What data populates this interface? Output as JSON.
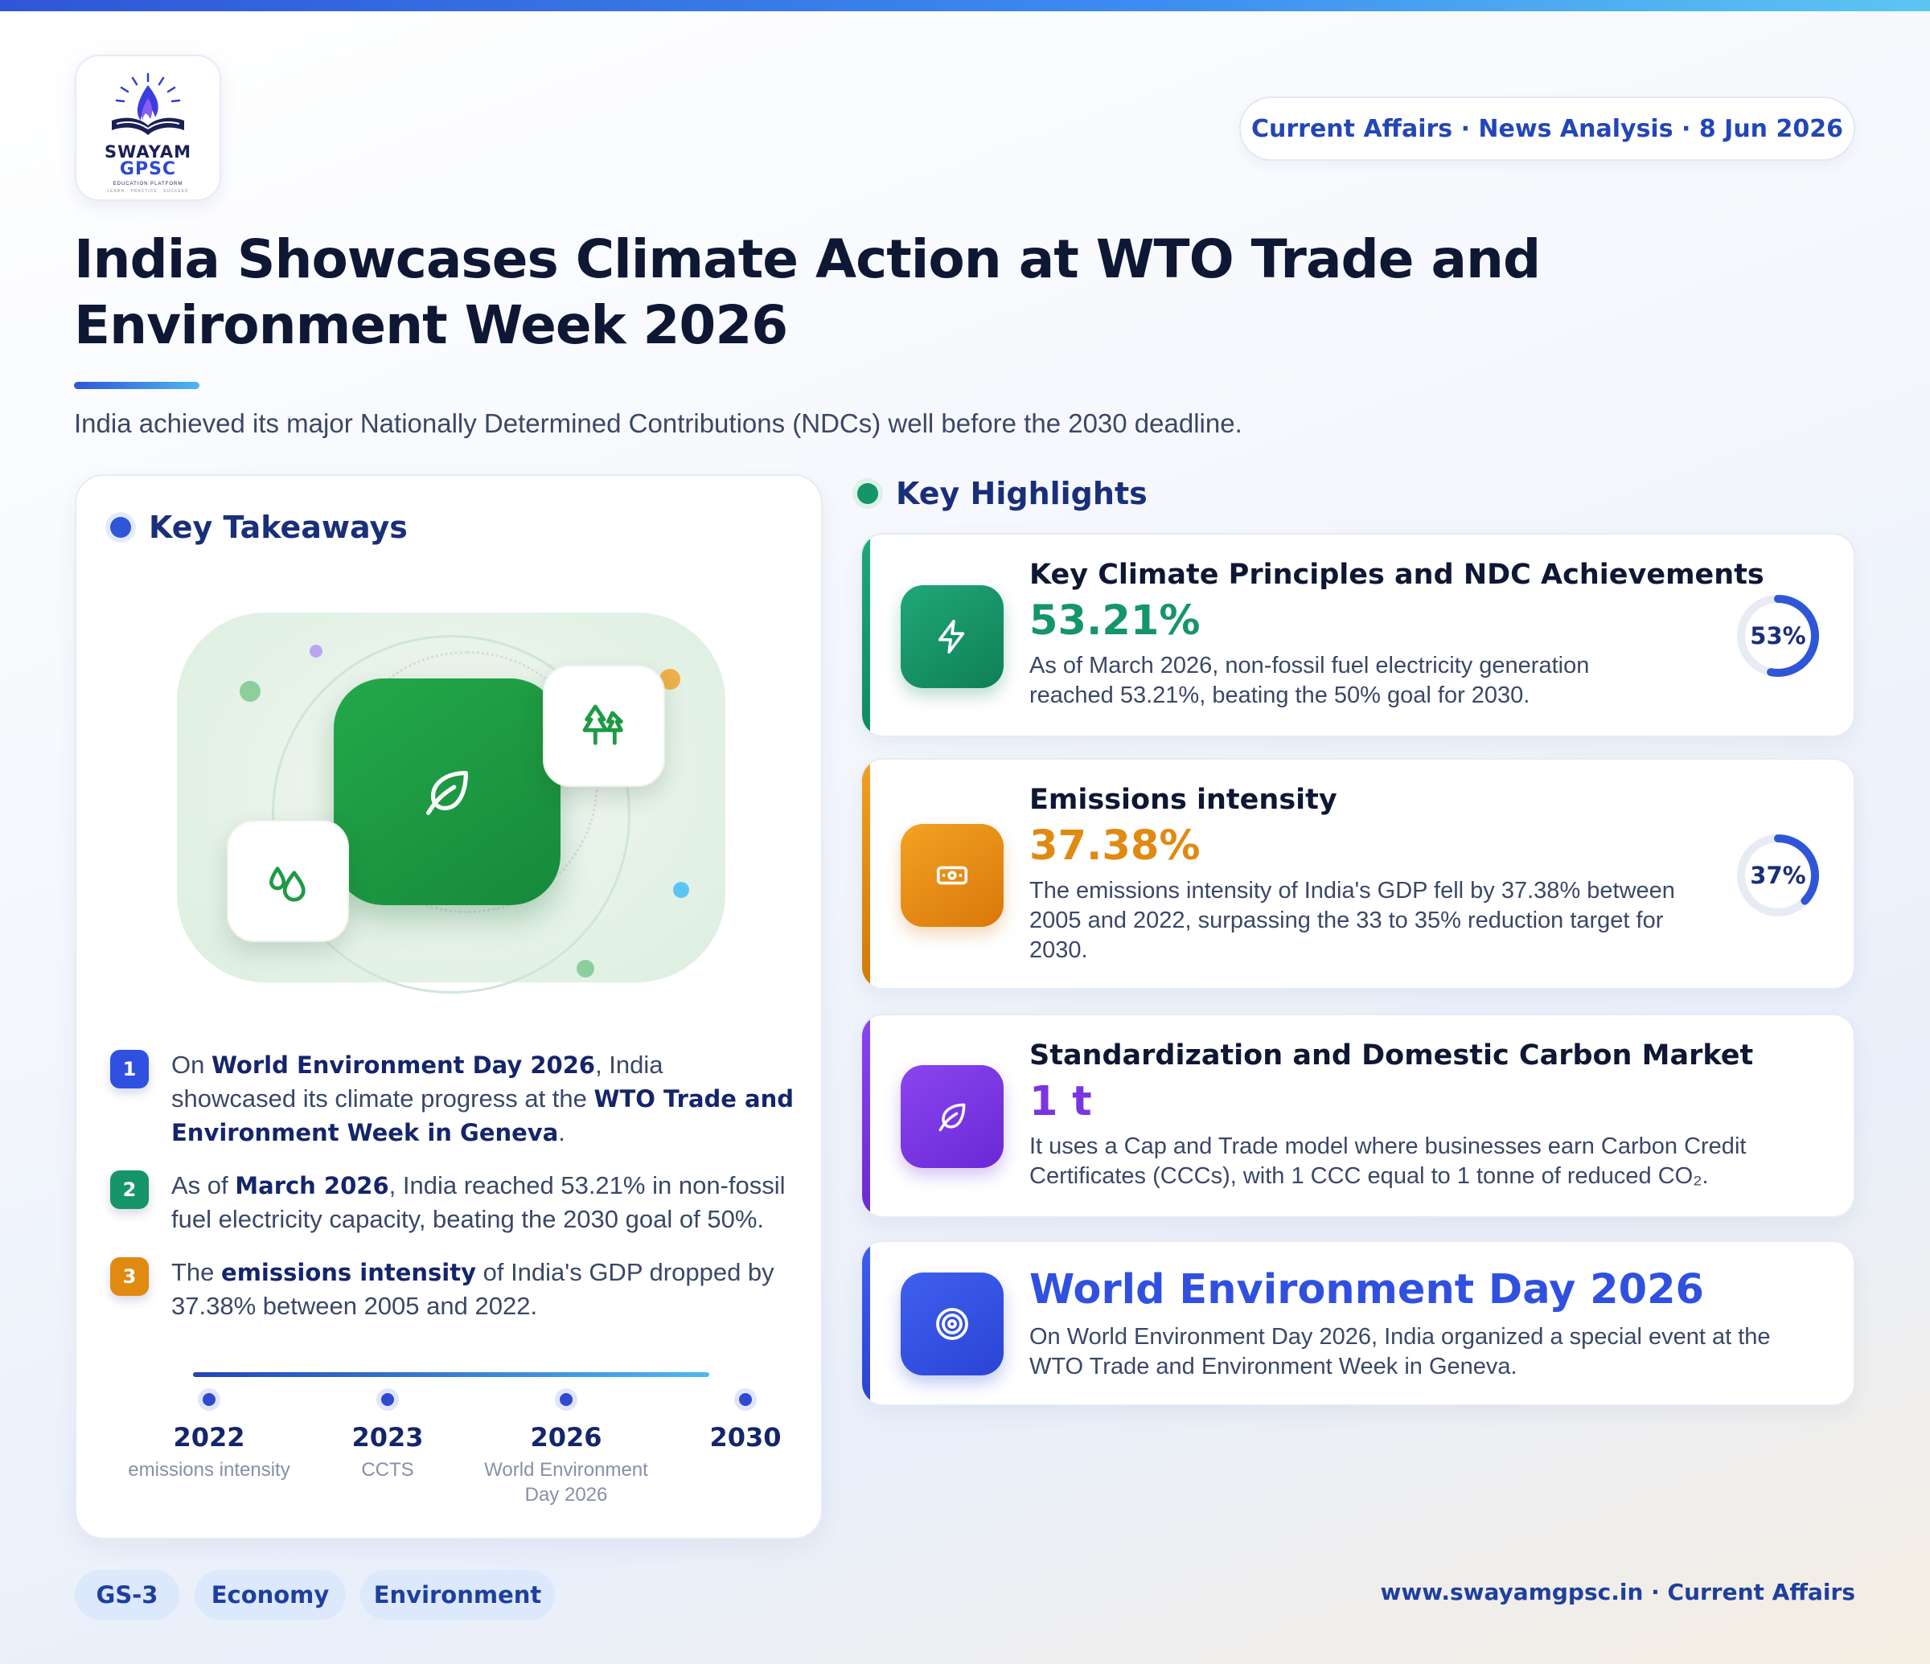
{
  "brand": {
    "name_line1": "SWAYAM",
    "name_line2": "GPSC",
    "tagline": "EDUCATION PLATFORM",
    "motto": "LEARN · PRACTICE · SUCCEED"
  },
  "header": {
    "date_pill": "Current Affairs · News Analysis · 8 Jun 2026",
    "title": "India Showcases Climate Action at WTO Trade and Environment Week 2026",
    "subtitle": "India achieved its major Nationally Determined Contributions (NDCs) well before the 2030 deadline."
  },
  "takeaways": {
    "heading": "Key Takeaways",
    "items": [
      {
        "num": "1",
        "p1": "On ",
        "b1": "World Environment Day 2026",
        "p2": ", India showcased its climate progress at the ",
        "b2": "WTO Trade and Environment Week in Geneva",
        "p3": "."
      },
      {
        "num": "2",
        "p1": "As of ",
        "b1": "March 2026",
        "p2": ", India reached 53.21% in non-fossil fuel electricity capacity, beating the 2030 goal of 50%."
      },
      {
        "num": "3",
        "p1": "The ",
        "b1": "emissions intensity",
        "p2": " of India's GDP dropped by 37.38% between 2005 and 2022."
      }
    ],
    "timeline": [
      {
        "year": "2022",
        "caption": "emissions intensity"
      },
      {
        "year": "2023",
        "caption": "CCTS"
      },
      {
        "year": "2026",
        "caption": "World Environment Day 2026"
      },
      {
        "year": "2030",
        "caption": ""
      }
    ]
  },
  "highlights": {
    "heading": "Key Highlights",
    "cards": [
      {
        "title": "Key Climate Principles and NDC Achievements",
        "stat": "53.21%",
        "desc": "As of March 2026, non-fossil fuel electricity generation reached 53.21%, beating the 50% goal for 2030.",
        "donut_label": "53%",
        "donut_value": 53,
        "color": "#16946a",
        "icon": "lightning-icon"
      },
      {
        "title": "Emissions intensity",
        "stat": "37.38%",
        "desc": "The emissions intensity of India's GDP fell by 37.38% between 2005 and 2022, surpassing the 33 to 35% reduction target for 2030.",
        "donut_label": "37%",
        "donut_value": 37,
        "color": "#e08a12",
        "icon": "banknote-icon"
      },
      {
        "title": "Standardization and Domestic Carbon Market",
        "stat": "1 t",
        "desc": "It uses a Cap and Trade model where businesses earn Carbon Credit Certificates (CCCs), with 1 CCC equal to 1 tonne of reduced CO₂.",
        "color": "#7a35e0",
        "icon": "leaf-icon"
      },
      {
        "title": "World Environment Day 2026",
        "desc": "On World Environment Day 2026, India organized a special event at the WTO Trade and Environment Week in Geneva.",
        "color": "#3050e0",
        "icon": "target-icon"
      }
    ]
  },
  "footer": {
    "tags": [
      "GS-3",
      "Economy",
      "Environment"
    ],
    "site": "www.swayamgpsc.in · Current Affairs"
  },
  "colors": {
    "accent_blue": "#2f56d8",
    "green": "#16946a",
    "orange": "#e08a12",
    "purple": "#7a35e0",
    "navy": "#14256b"
  }
}
